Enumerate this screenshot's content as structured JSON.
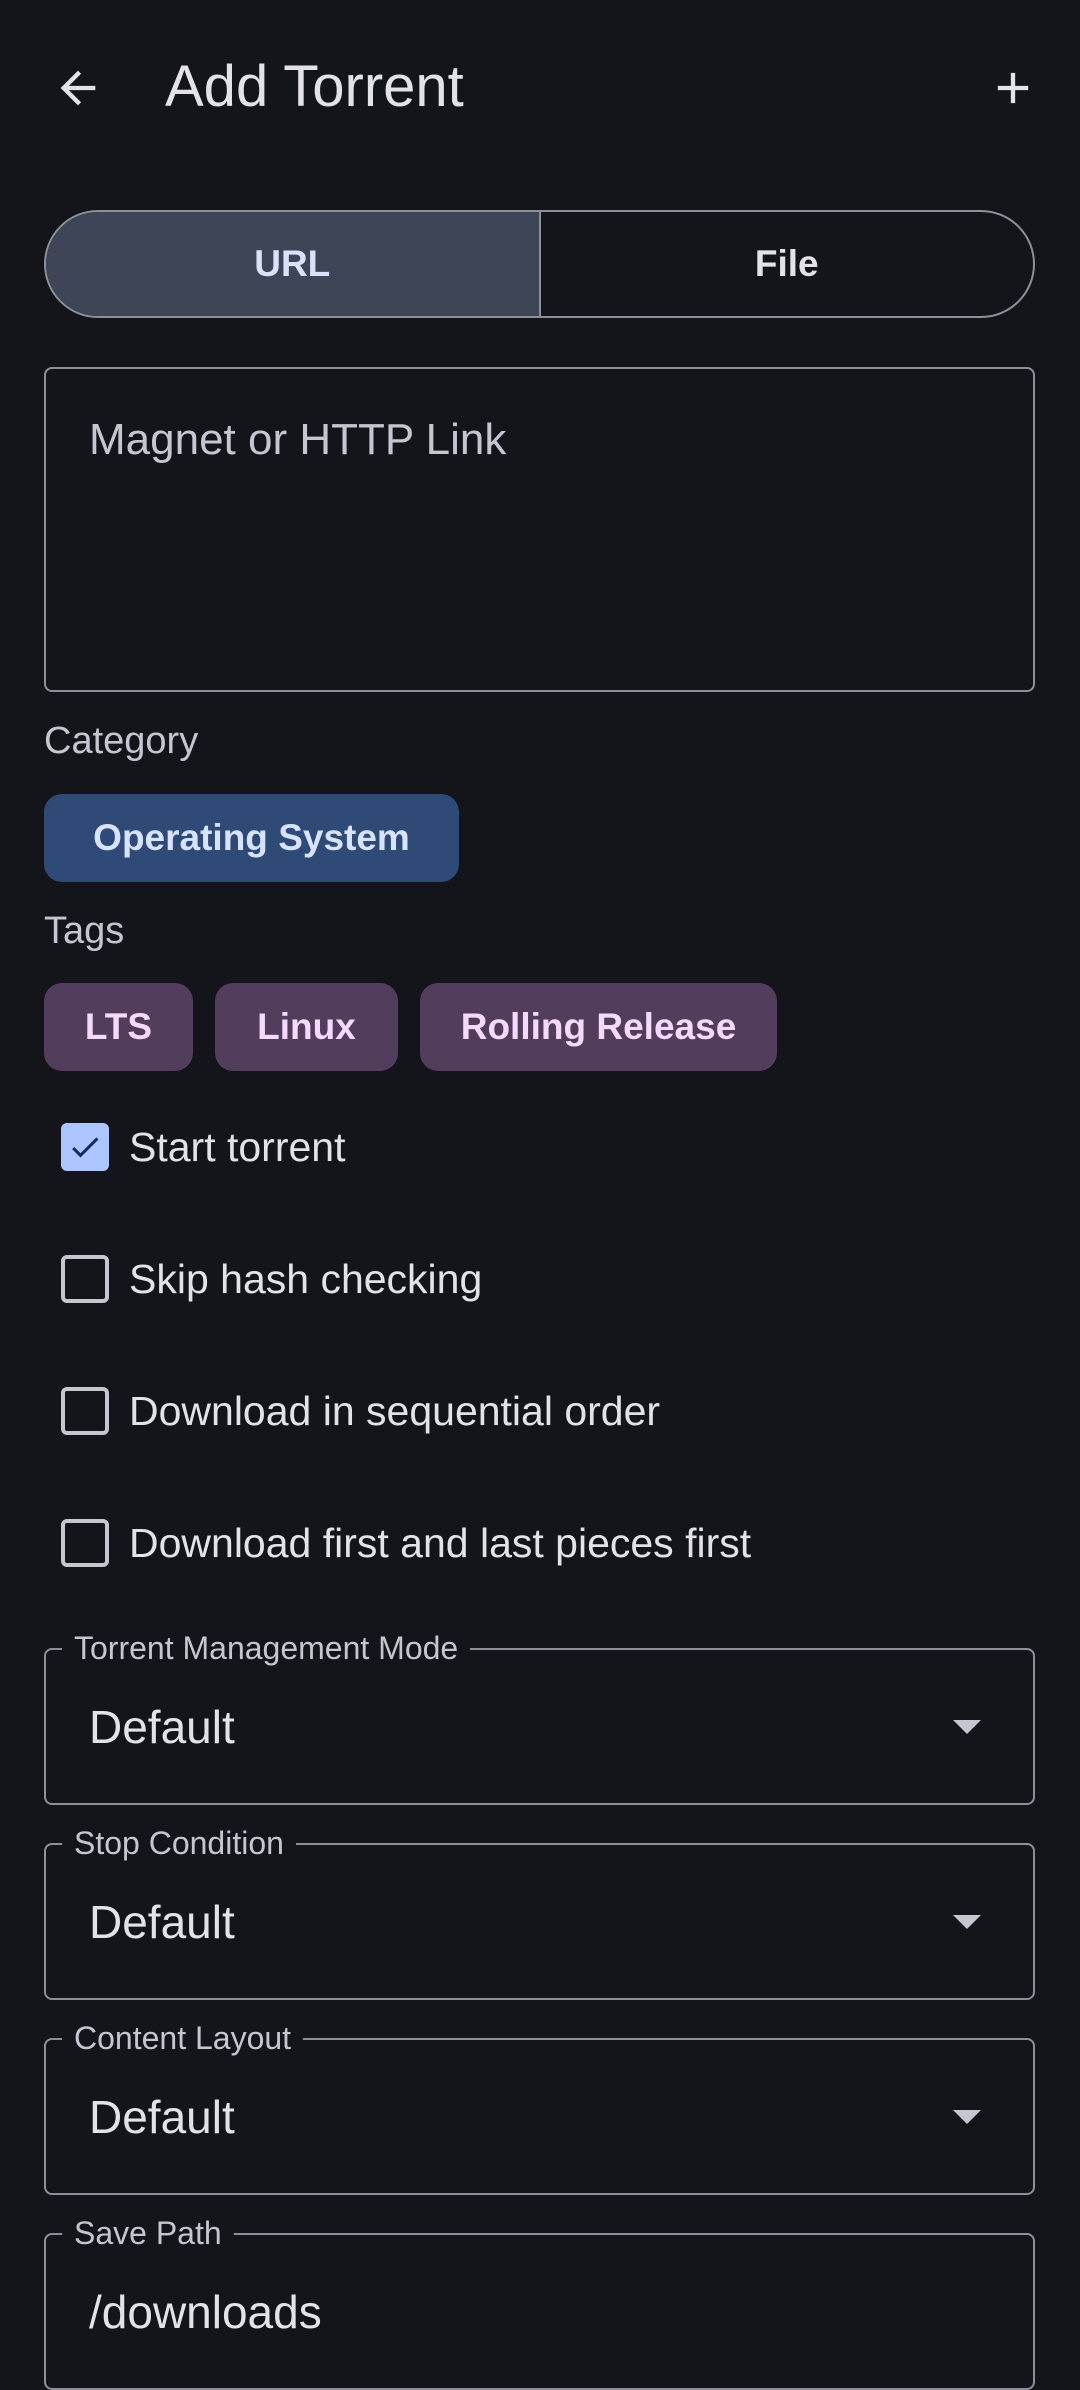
{
  "header": {
    "title": "Add Torrent",
    "back_icon": "arrow-back-icon",
    "add_icon": "plus-icon"
  },
  "source_tabs": {
    "url_label": "URL",
    "file_label": "File",
    "selected": "URL"
  },
  "url_input": {
    "placeholder": "Magnet or HTTP Link",
    "value": ""
  },
  "category": {
    "label": "Category",
    "selected": "Operating System"
  },
  "tags": {
    "label": "Tags",
    "items": [
      "LTS",
      "Linux",
      "Rolling Release"
    ]
  },
  "options": [
    {
      "label": "Start torrent",
      "checked": true
    },
    {
      "label": "Skip hash checking",
      "checked": false
    },
    {
      "label": "Download in sequential order",
      "checked": false
    },
    {
      "label": "Download first and last pieces first",
      "checked": false
    }
  ],
  "fields": {
    "management_mode": {
      "label": "Torrent Management Mode",
      "value": "Default"
    },
    "stop_condition": {
      "label": "Stop Condition",
      "value": "Default"
    },
    "content_layout": {
      "label": "Content Layout",
      "value": "Default"
    },
    "save_path": {
      "label": "Save Path",
      "value": "/downloads"
    }
  },
  "colors": {
    "background": "#14151b",
    "segment_selected": "#3d4556",
    "category_chip": "#2f4a77",
    "tag_chip": "#523d5c",
    "checkbox_checked": "#aec6ff"
  }
}
